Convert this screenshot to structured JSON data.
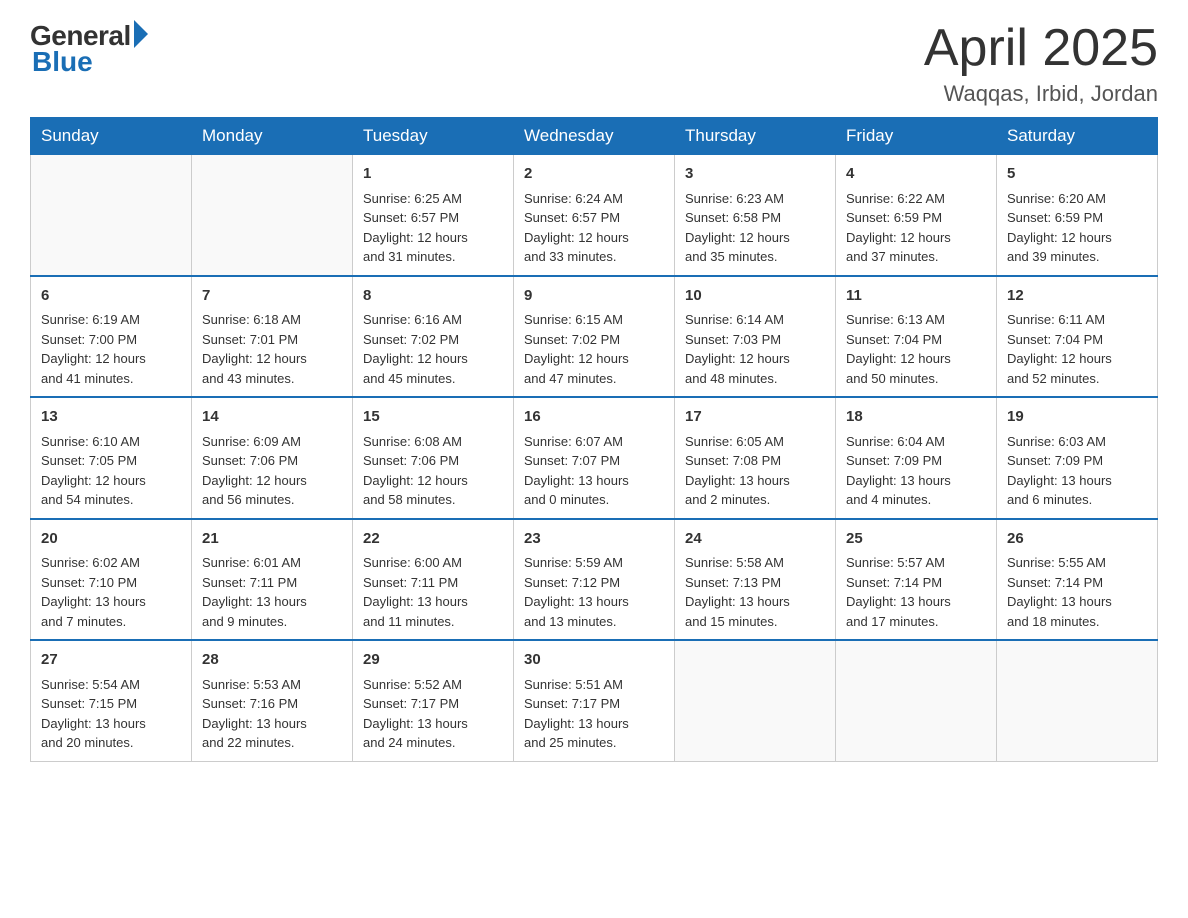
{
  "logo": {
    "general": "General",
    "blue": "Blue"
  },
  "title": "April 2025",
  "location": "Waqqas, Irbid, Jordan",
  "days_of_week": [
    "Sunday",
    "Monday",
    "Tuesday",
    "Wednesday",
    "Thursday",
    "Friday",
    "Saturday"
  ],
  "weeks": [
    [
      {
        "day": "",
        "info": ""
      },
      {
        "day": "",
        "info": ""
      },
      {
        "day": "1",
        "info": "Sunrise: 6:25 AM\nSunset: 6:57 PM\nDaylight: 12 hours\nand 31 minutes."
      },
      {
        "day": "2",
        "info": "Sunrise: 6:24 AM\nSunset: 6:57 PM\nDaylight: 12 hours\nand 33 minutes."
      },
      {
        "day": "3",
        "info": "Sunrise: 6:23 AM\nSunset: 6:58 PM\nDaylight: 12 hours\nand 35 minutes."
      },
      {
        "day": "4",
        "info": "Sunrise: 6:22 AM\nSunset: 6:59 PM\nDaylight: 12 hours\nand 37 minutes."
      },
      {
        "day": "5",
        "info": "Sunrise: 6:20 AM\nSunset: 6:59 PM\nDaylight: 12 hours\nand 39 minutes."
      }
    ],
    [
      {
        "day": "6",
        "info": "Sunrise: 6:19 AM\nSunset: 7:00 PM\nDaylight: 12 hours\nand 41 minutes."
      },
      {
        "day": "7",
        "info": "Sunrise: 6:18 AM\nSunset: 7:01 PM\nDaylight: 12 hours\nand 43 minutes."
      },
      {
        "day": "8",
        "info": "Sunrise: 6:16 AM\nSunset: 7:02 PM\nDaylight: 12 hours\nand 45 minutes."
      },
      {
        "day": "9",
        "info": "Sunrise: 6:15 AM\nSunset: 7:02 PM\nDaylight: 12 hours\nand 47 minutes."
      },
      {
        "day": "10",
        "info": "Sunrise: 6:14 AM\nSunset: 7:03 PM\nDaylight: 12 hours\nand 48 minutes."
      },
      {
        "day": "11",
        "info": "Sunrise: 6:13 AM\nSunset: 7:04 PM\nDaylight: 12 hours\nand 50 minutes."
      },
      {
        "day": "12",
        "info": "Sunrise: 6:11 AM\nSunset: 7:04 PM\nDaylight: 12 hours\nand 52 minutes."
      }
    ],
    [
      {
        "day": "13",
        "info": "Sunrise: 6:10 AM\nSunset: 7:05 PM\nDaylight: 12 hours\nand 54 minutes."
      },
      {
        "day": "14",
        "info": "Sunrise: 6:09 AM\nSunset: 7:06 PM\nDaylight: 12 hours\nand 56 minutes."
      },
      {
        "day": "15",
        "info": "Sunrise: 6:08 AM\nSunset: 7:06 PM\nDaylight: 12 hours\nand 58 minutes."
      },
      {
        "day": "16",
        "info": "Sunrise: 6:07 AM\nSunset: 7:07 PM\nDaylight: 13 hours\nand 0 minutes."
      },
      {
        "day": "17",
        "info": "Sunrise: 6:05 AM\nSunset: 7:08 PM\nDaylight: 13 hours\nand 2 minutes."
      },
      {
        "day": "18",
        "info": "Sunrise: 6:04 AM\nSunset: 7:09 PM\nDaylight: 13 hours\nand 4 minutes."
      },
      {
        "day": "19",
        "info": "Sunrise: 6:03 AM\nSunset: 7:09 PM\nDaylight: 13 hours\nand 6 minutes."
      }
    ],
    [
      {
        "day": "20",
        "info": "Sunrise: 6:02 AM\nSunset: 7:10 PM\nDaylight: 13 hours\nand 7 minutes."
      },
      {
        "day": "21",
        "info": "Sunrise: 6:01 AM\nSunset: 7:11 PM\nDaylight: 13 hours\nand 9 minutes."
      },
      {
        "day": "22",
        "info": "Sunrise: 6:00 AM\nSunset: 7:11 PM\nDaylight: 13 hours\nand 11 minutes."
      },
      {
        "day": "23",
        "info": "Sunrise: 5:59 AM\nSunset: 7:12 PM\nDaylight: 13 hours\nand 13 minutes."
      },
      {
        "day": "24",
        "info": "Sunrise: 5:58 AM\nSunset: 7:13 PM\nDaylight: 13 hours\nand 15 minutes."
      },
      {
        "day": "25",
        "info": "Sunrise: 5:57 AM\nSunset: 7:14 PM\nDaylight: 13 hours\nand 17 minutes."
      },
      {
        "day": "26",
        "info": "Sunrise: 5:55 AM\nSunset: 7:14 PM\nDaylight: 13 hours\nand 18 minutes."
      }
    ],
    [
      {
        "day": "27",
        "info": "Sunrise: 5:54 AM\nSunset: 7:15 PM\nDaylight: 13 hours\nand 20 minutes."
      },
      {
        "day": "28",
        "info": "Sunrise: 5:53 AM\nSunset: 7:16 PM\nDaylight: 13 hours\nand 22 minutes."
      },
      {
        "day": "29",
        "info": "Sunrise: 5:52 AM\nSunset: 7:17 PM\nDaylight: 13 hours\nand 24 minutes."
      },
      {
        "day": "30",
        "info": "Sunrise: 5:51 AM\nSunset: 7:17 PM\nDaylight: 13 hours\nand 25 minutes."
      },
      {
        "day": "",
        "info": ""
      },
      {
        "day": "",
        "info": ""
      },
      {
        "day": "",
        "info": ""
      }
    ]
  ]
}
